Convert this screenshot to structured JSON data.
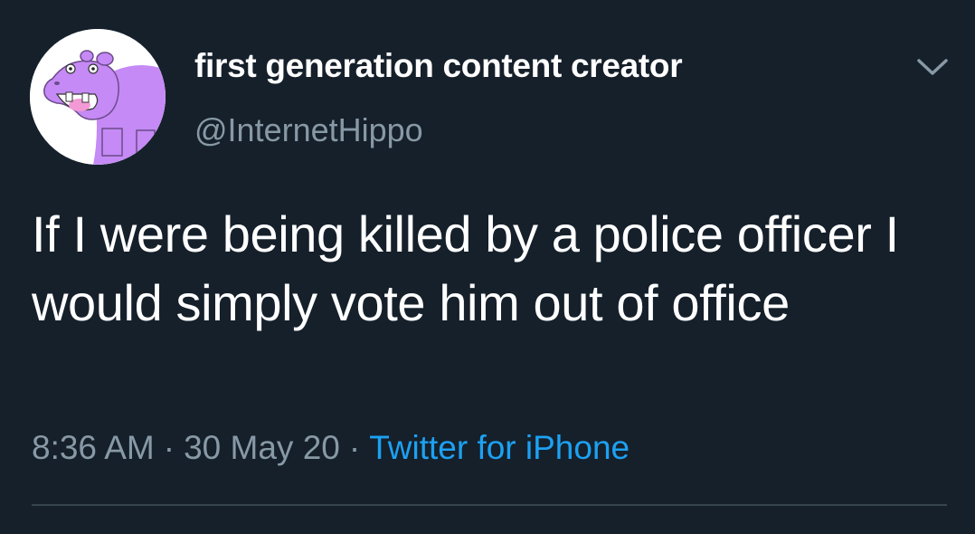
{
  "author": {
    "display_name": "first generation content creator",
    "handle": "@InternetHippo",
    "avatar_icon": "purple-hippo-avatar"
  },
  "tweet": {
    "text": "If I were being killed by a police officer I would simply vote him out of office"
  },
  "meta": {
    "time": "8:36 AM",
    "separator": "·",
    "date": "30 May 20",
    "source": "Twitter for iPhone"
  },
  "icons": {
    "menu": "chevron-down-icon"
  },
  "colors": {
    "background": "#15202b",
    "primary_text": "#ffffff",
    "secondary_text": "#8899a6",
    "link": "#1da1f2",
    "divider": "#38444d",
    "avatar_hippo": "#c58af5"
  }
}
